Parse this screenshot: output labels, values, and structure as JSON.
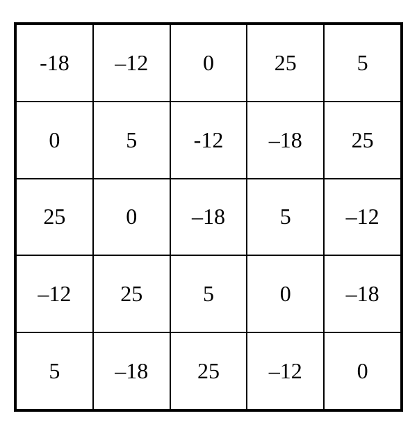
{
  "grid": {
    "rows": [
      {
        "cells": [
          "-18",
          "–12",
          "0",
          "25",
          "5"
        ]
      },
      {
        "cells": [
          "0",
          "5",
          "-12",
          "–18",
          "25"
        ]
      },
      {
        "cells": [
          "25",
          "0",
          "–18",
          "5",
          "–12"
        ]
      },
      {
        "cells": [
          "–12",
          "25",
          "5",
          "0",
          "–18"
        ]
      },
      {
        "cells": [
          "5",
          "–18",
          "25",
          "–12",
          "0"
        ]
      }
    ]
  }
}
